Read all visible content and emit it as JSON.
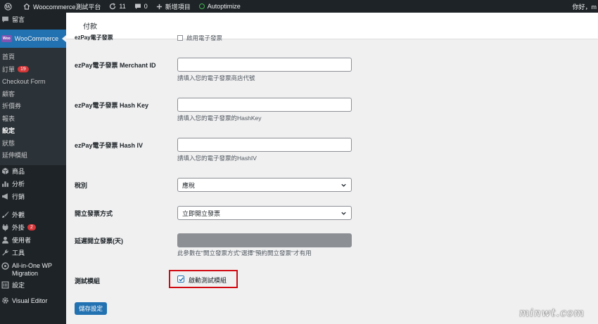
{
  "adminbar": {
    "site_name": "Woocommerce測試平台",
    "updates_count": "11",
    "comments_count": "0",
    "new_item": "新增項目",
    "autoptimize": "Autoptimize",
    "greeting": "你好，m"
  },
  "sidebar": {
    "comments": "留言",
    "woocommerce": "WooCommerce",
    "woo_badge": "Woo",
    "submenu": [
      {
        "label": "首頁"
      },
      {
        "label": "訂單",
        "count": "19"
      },
      {
        "label": "Checkout Form"
      },
      {
        "label": "顧客"
      },
      {
        "label": "折價券"
      },
      {
        "label": "報表"
      },
      {
        "label": "設定"
      },
      {
        "label": "狀態"
      },
      {
        "label": "延伸模組"
      }
    ],
    "products": "商品",
    "analytics": "分析",
    "marketing": "行銷",
    "appearance": "外觀",
    "plugins": "外掛",
    "plugins_count": "2",
    "users": "使用者",
    "tools": "工具",
    "all_in_one": "All-in-One WP Migration",
    "settings": "設定",
    "visual_editor": "Visual Editor"
  },
  "header": {
    "tab": "付款"
  },
  "form": {
    "top_partial_label": "ezPay電子發票",
    "top_partial_value": "啟用電子發票",
    "merchant_id": {
      "label": "ezPay電子發票 Merchant ID",
      "desc": "請填入您的電子發票商店代號"
    },
    "hash_key": {
      "label": "ezPay電子發票 Hash Key",
      "desc": "請填入您的電子發票的HashKey"
    },
    "hash_iv": {
      "label": "ezPay電子發票 Hash IV",
      "desc": "請填入您的電子發票的HashIV"
    },
    "tax_type": {
      "label": "稅別",
      "value": "應稅"
    },
    "issue_method": {
      "label": "開立發票方式",
      "value": "立即開立發票"
    },
    "delay_days": {
      "label": "延遲開立發票(天)",
      "desc": "此參數在\"開立發票方式\"選擇\"預約開立發票\"才有用"
    },
    "test_mode": {
      "label": "測試模組",
      "checkbox_label": "啟動測試模組",
      "checked": true
    },
    "save": "儲存設定"
  },
  "watermark": "minwt.com"
}
